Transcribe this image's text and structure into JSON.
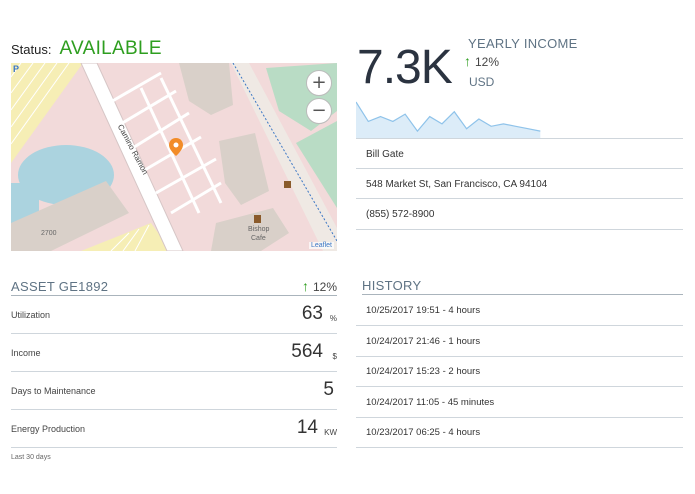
{
  "status": {
    "label": "Status:",
    "value": "AVAILABLE"
  },
  "map": {
    "zoom_in": "+",
    "zoom_out": "−",
    "attribution": "Leaflet",
    "street": "Camino Ramon",
    "building_number": "2700",
    "cafe_name": "Bishop",
    "cafe_label": "Cafe",
    "parking": "P"
  },
  "kpi": {
    "value": "7.3K",
    "title": "YEARLY INCOME",
    "trend_arrow": "↑",
    "trend": "12%",
    "unit": "USD",
    "sparkline": [
      14,
      6,
      8,
      6,
      9,
      2,
      8,
      5,
      10,
      3,
      7,
      4,
      5,
      4,
      3,
      2
    ],
    "colors": {
      "line": "#8fc3ea",
      "fill": "#dcecf8"
    }
  },
  "contact": {
    "name": "Bill Gate",
    "address": "548 Market St, San Francisco, CA 94104",
    "phone": "(855) 572-8900"
  },
  "asset": {
    "title": "ASSET GE1892",
    "trend_arrow": "↑",
    "trend": "12%",
    "metrics": [
      {
        "label": "Utilization",
        "value": "63",
        "unit": "%"
      },
      {
        "label": "Income",
        "value": "564",
        "unit": "$"
      },
      {
        "label": "Days to Maintenance",
        "value": "5",
        "unit": ""
      },
      {
        "label": "Energy Production",
        "value": "14",
        "unit": "KW"
      }
    ],
    "footnote": "Last 30 days"
  },
  "history": {
    "title": "HISTORY",
    "items": [
      "10/25/2017 19:51 - 4 hours",
      "10/24/2017 21:46 - 1 hours",
      "10/24/2017 15:23 - 2 hours",
      "10/24/2017 11:05 - 45 minutes",
      "10/23/2017 06:25 - 4 hours"
    ]
  },
  "colors": {
    "available": "#2e9e1f",
    "accent_title": "#5f7384",
    "up_arrow": "#2e9e1f"
  }
}
